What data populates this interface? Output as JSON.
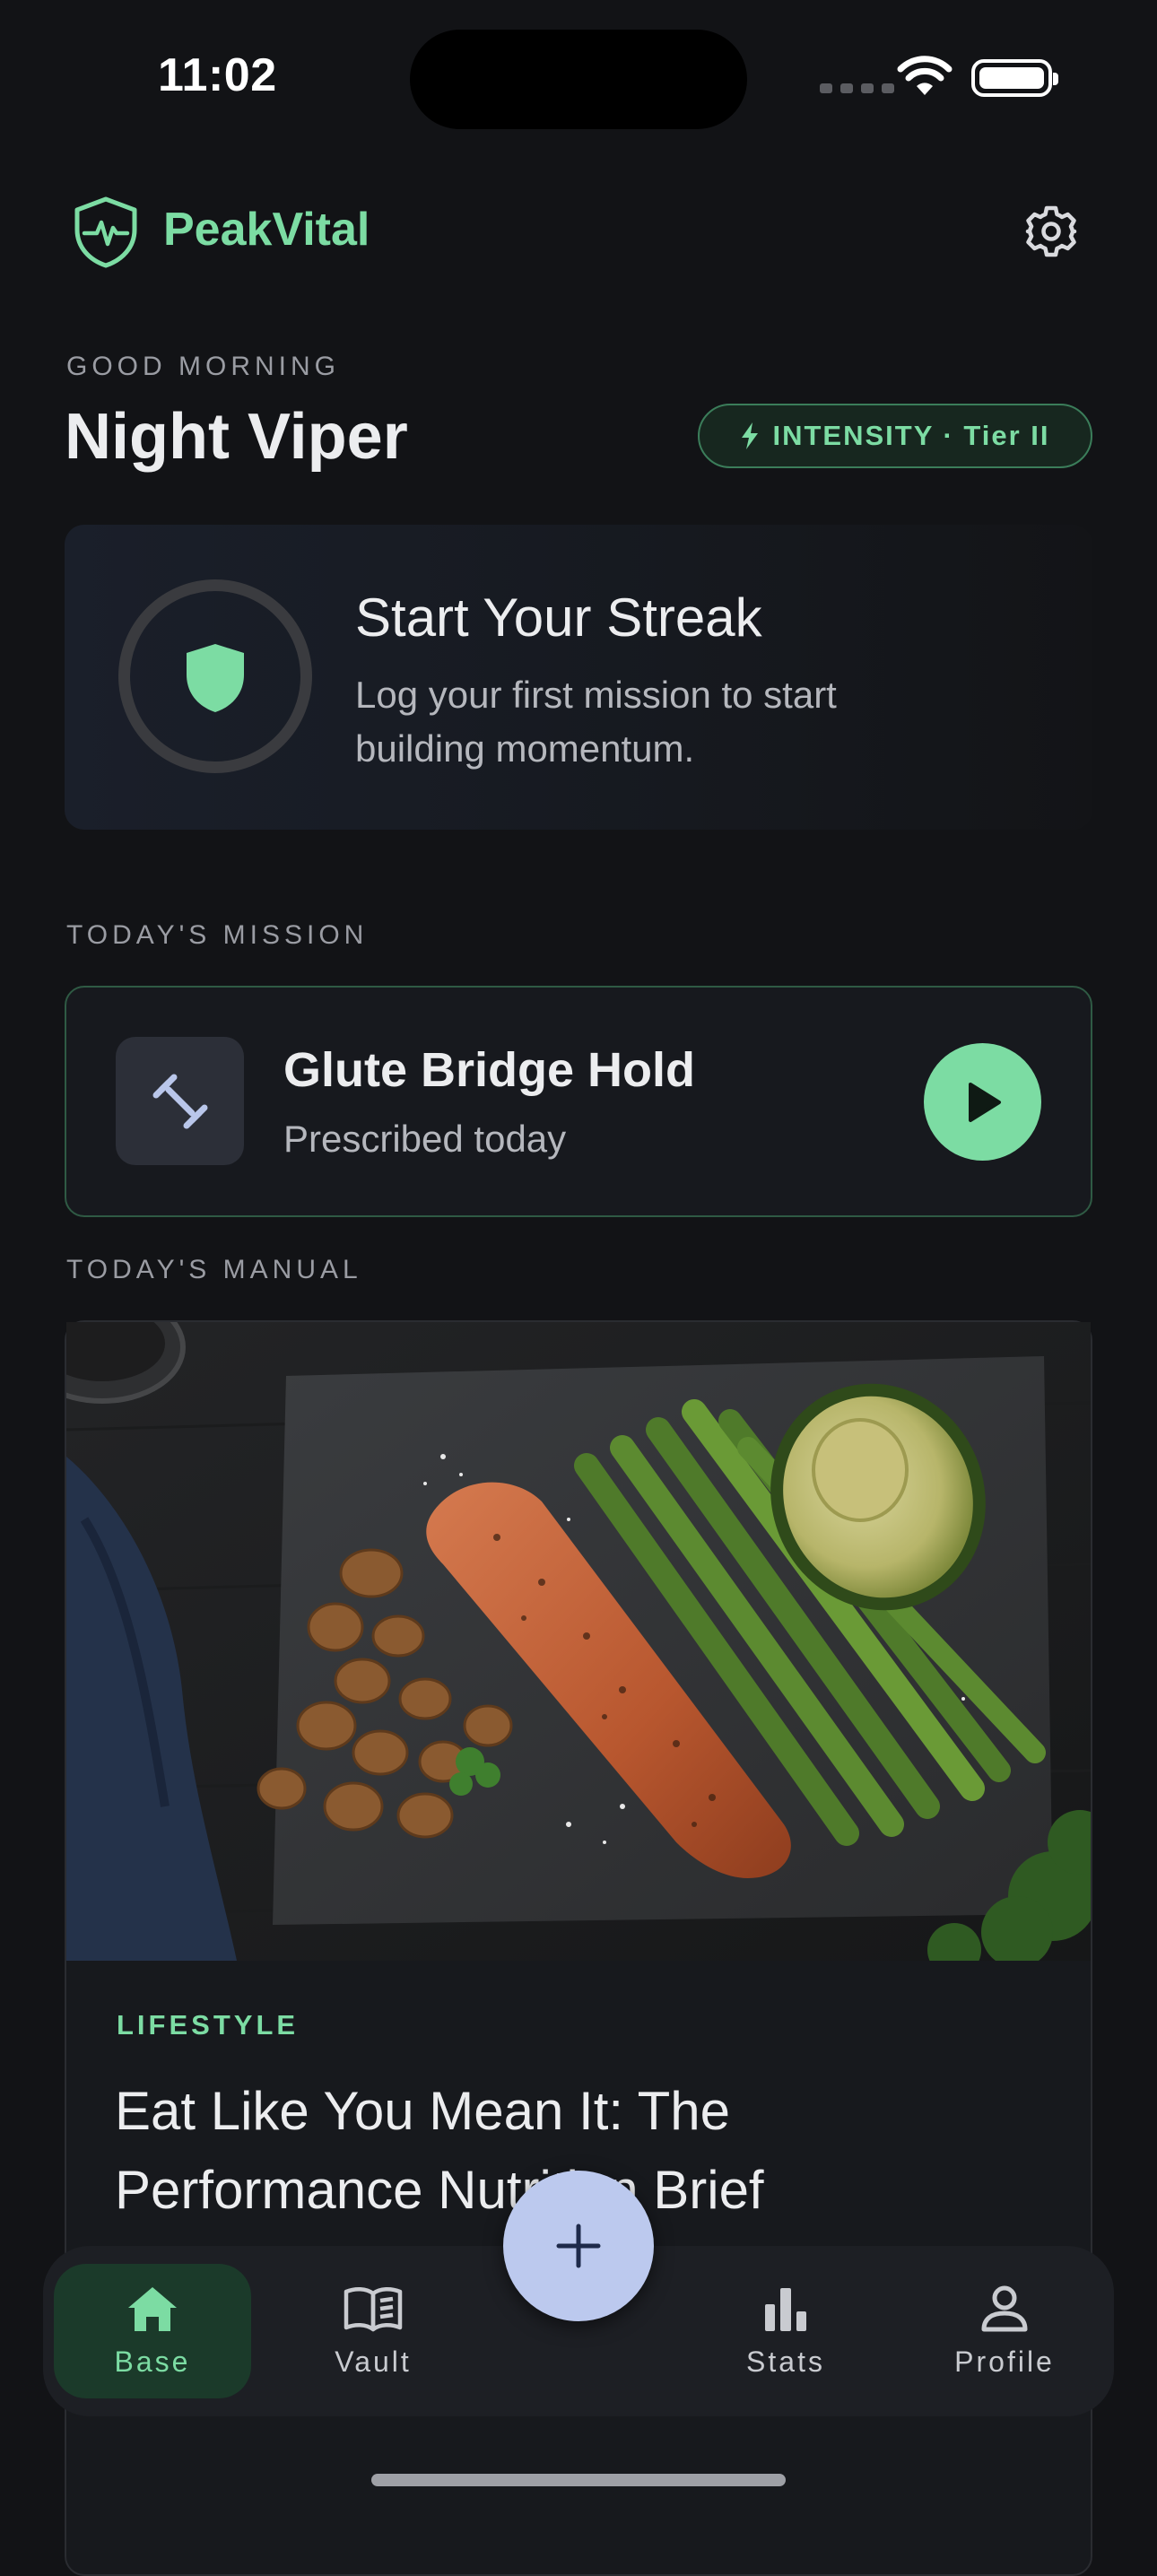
{
  "status_bar": {
    "time": "11:02"
  },
  "header": {
    "brand": "PeakVital"
  },
  "greeting": {
    "label": "GOOD MORNING",
    "name": "Night Viper",
    "intensity_badge": "INTENSITY · Tier II"
  },
  "streak": {
    "title": "Start Your Streak",
    "subtitle": "Log your first mission to start building momentum."
  },
  "mission": {
    "section_label": "TODAY'S MISSION",
    "title": "Glute Bridge Hold",
    "subtitle": "Prescribed today"
  },
  "manual": {
    "section_label": "TODAY'S MANUAL",
    "category": "LIFESTYLE",
    "title": "Eat Like You Mean It: The Performance Nutrition Brief"
  },
  "tabbar": {
    "items": [
      {
        "label": "Base",
        "icon": "home-icon",
        "active": true
      },
      {
        "label": "Vault",
        "icon": "book-icon",
        "active": false
      },
      {
        "label": "Stats",
        "icon": "bar-chart-icon",
        "active": false
      },
      {
        "label": "Profile",
        "icon": "person-icon",
        "active": false
      }
    ],
    "fab_icon": "plus-icon"
  },
  "colors": {
    "background": "#121316",
    "accent_green": "#7CDCA3",
    "fab": "#bcc9ee"
  }
}
